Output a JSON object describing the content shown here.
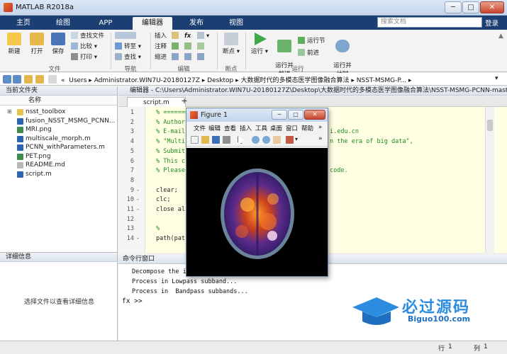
{
  "app": {
    "title": "MATLAB R2018a",
    "tabs": [
      "主页",
      "绘图",
      "APP",
      "编辑器",
      "发布",
      "视图"
    ],
    "search_placeholder": "搜索文档",
    "login": "登录"
  },
  "toolstrip": {
    "file": {
      "new": "新建",
      "open": "打开",
      "save": "保存",
      "find_files": "查找文件",
      "compare": "比较",
      "print": "打印",
      "section": "文件"
    },
    "navigate": {
      "goto": "转至",
      "find": "查找",
      "section": "导航"
    },
    "edit": {
      "insert": "插入",
      "fx": "fx",
      "comment": "注释",
      "indent": "缩进",
      "section": "编辑"
    },
    "breakpoints": {
      "breakpoints": "断点",
      "section": "断点"
    },
    "run": {
      "run": "运行",
      "run_advance": "运行并\n前进",
      "run_section": "运行节",
      "advance": "前进",
      "run_time": "运行并\n计时",
      "section": "运行"
    }
  },
  "address": {
    "path": [
      "Users",
      "Administrator.WIN7U-20180127Z",
      "Desktop",
      "大数据时代的多模态医学图像融合算法",
      "NSST-MSMG-PCNN-master"
    ],
    "truncated_tail": "NSST-MSMG-P..."
  },
  "current_folder": {
    "title": "当前文件夹",
    "column": "名称",
    "files": [
      {
        "name": "nsst_toolbox",
        "type": "folder"
      },
      {
        "name": "fusion_NSST_MSMG_PCNN...",
        "type": "m"
      },
      {
        "name": "MRI.png",
        "type": "png"
      },
      {
        "name": "multiscale_morph.m",
        "type": "m"
      },
      {
        "name": "PCNN_withParameters.m",
        "type": "m"
      },
      {
        "name": "PET.png",
        "type": "png"
      },
      {
        "name": "README.md",
        "type": "md"
      },
      {
        "name": "script.m",
        "type": "m"
      }
    ]
  },
  "details": {
    "title": "详细信息",
    "message": "选择文件以查看详细信息"
  },
  "editor": {
    "title": "编辑器 - C:\\Users\\Administrator.WIN7U-20180127Z\\Desktop\\大数据时代的多模态医学图像融合算法\\NSST-MSMG-PCNN-master\\script.m",
    "tab": "script.m",
    "add_tab": "+",
    "lines": [
      {
        "n": "1",
        "dash": "",
        "code": "% ========",
        "comment": true
      },
      {
        "n": "2",
        "dash": "",
        "code": "% Author",
        "comment": true
      },
      {
        "n": "3",
        "dash": "",
        "code": "% E-mail",
        "comment": true,
        "tail": "i.edu.cn"
      },
      {
        "n": "4",
        "dash": "",
        "code": "% \"Multi",
        "comment": true,
        "tail": "n the era of big data\","
      },
      {
        "n": "5",
        "dash": "",
        "code": "% Submit",
        "comment": true
      },
      {
        "n": "6",
        "dash": "",
        "code": "% This c",
        "comment": true
      },
      {
        "n": "7",
        "dash": "",
        "code": "% Please",
        "comment": true,
        "tail": "code."
      },
      {
        "n": "8",
        "dash": "",
        "code": "",
        "comment": false
      },
      {
        "n": "9",
        "dash": "-",
        "code": "clear;",
        "comment": false
      },
      {
        "n": "10",
        "dash": "-",
        "code": "clc;",
        "comment": false
      },
      {
        "n": "11",
        "dash": "-",
        "code": "close al",
        "comment": false
      },
      {
        "n": "12",
        "dash": "",
        "code": "",
        "comment": false
      },
      {
        "n": "13",
        "dash": "",
        "code": "%",
        "comment": true
      },
      {
        "n": "14",
        "dash": "-",
        "code": "path(pat",
        "comment": false
      }
    ]
  },
  "command_window": {
    "title": "命令行窗口",
    "lines": [
      "Decompose the i",
      "Process in Lowpass subband...",
      "Process in  Bandpass subbands..."
    ],
    "prompt": "fx >>"
  },
  "status": {
    "row_label": "行",
    "row": "1",
    "col_label": "列",
    "col": "1"
  },
  "figure": {
    "title": "Figure 1",
    "menu": [
      "文件",
      "编辑",
      "查看",
      "插入",
      "工具",
      "桌面",
      "窗口",
      "帮助"
    ]
  },
  "watermark": {
    "text": "必过源码",
    "url": "Biguo100.com"
  },
  "colors": {
    "tabbar": "#1c3f73",
    "editor_bg": "#ffffe4",
    "comment": "#228b22"
  }
}
